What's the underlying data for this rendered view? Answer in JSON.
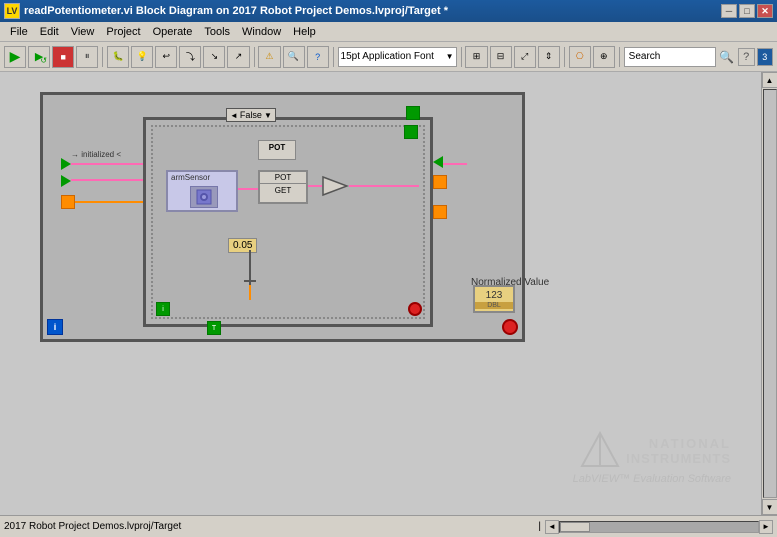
{
  "titleBar": {
    "title": "readPotentiometer.vi Block Diagram on 2017 Robot Project Demos.lvproj/Target *",
    "iconText": "LV"
  },
  "menu": {
    "items": [
      "File",
      "Edit",
      "View",
      "Project",
      "Operate",
      "Tools",
      "Window",
      "Help"
    ]
  },
  "toolbar": {
    "fontSelector": "15pt Application Font",
    "searchPlaceholder": "Search",
    "searchValue": "Search"
  },
  "diagram": {
    "falseLabel": "False",
    "armSensorLabel": "armSensor",
    "potLabel": "POT",
    "getLabel": "GET",
    "valueLabel": "0.05",
    "normalizedValueLabel": "Normalized Value",
    "dblNumber": "123",
    "dblTypeLabel": "DBL",
    "infoIcon": "i",
    "stopIcon": "●"
  },
  "statusBar": {
    "projectText": "2017 Robot Project Demos.lvproj/Target"
  },
  "watermark": {
    "line1": "NATIONAL",
    "line2": "INSTRUMENTS",
    "line3": "LabVIEW™ Evaluation Software"
  },
  "icons": {
    "runArrow": "▶",
    "pause": "⏸",
    "stop": "■",
    "abort": "✕",
    "search": "🔍",
    "help": "?",
    "scrollUp": "▲",
    "scrollDown": "▼",
    "scrollLeft": "◄",
    "scrollRight": "►",
    "chevronDown": "▼",
    "checkbox": "☑",
    "pencil": "✎",
    "settings": "⚙"
  }
}
